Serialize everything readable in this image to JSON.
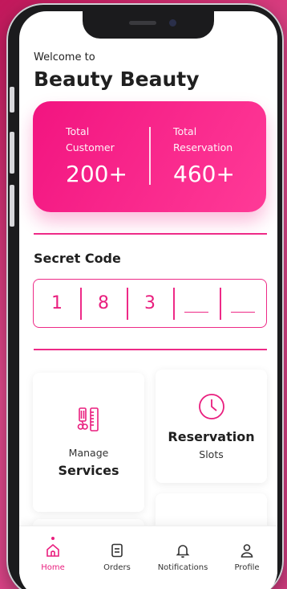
{
  "header": {
    "welcome_text": "Welcome to",
    "shop_name": "Beauty Beauty"
  },
  "stats": {
    "customers_label_1": "Total",
    "customers_label_2": "Customer",
    "customers_value": "200+",
    "reservations_label_1": "Total",
    "reservations_label_2": "Reservation",
    "reservations_value": "460+"
  },
  "secret_code": {
    "title": "Secret Code",
    "digits": [
      "1",
      "8",
      "3",
      "",
      ""
    ]
  },
  "tiles": {
    "services_small": "Manage",
    "services_big": "Services",
    "reservation_big": "Reservation",
    "reservation_small": "Slots"
  },
  "bottom_nav": {
    "items": [
      {
        "label": "Home",
        "icon": "home-icon",
        "active": true
      },
      {
        "label": "Orders",
        "icon": "orders-icon",
        "active": false
      },
      {
        "label": "Notifications",
        "icon": "bell-icon",
        "active": false
      },
      {
        "label": "Profile",
        "icon": "profile-icon",
        "active": false
      }
    ]
  },
  "colors": {
    "accent": "#e91e7e",
    "card_gradient_start": "#f21480",
    "card_gradient_end": "#ff3a97",
    "background": "#d23c80"
  }
}
